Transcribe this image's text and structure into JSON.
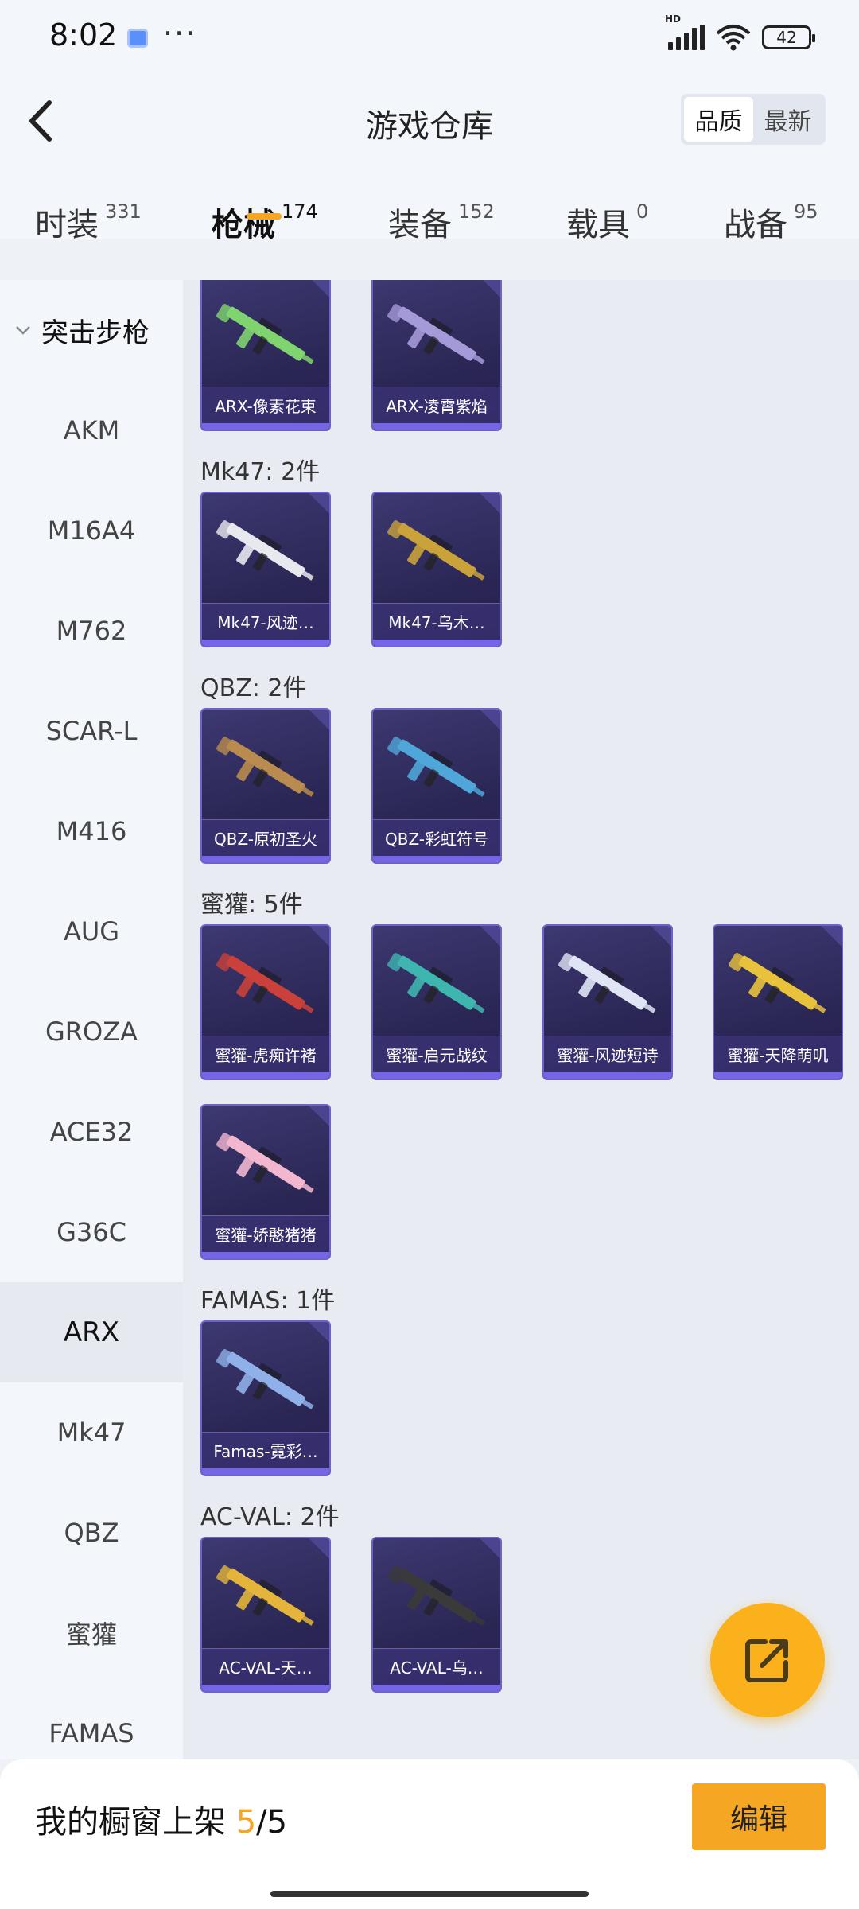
{
  "status_bar": {
    "time": "8:02",
    "dots": "···",
    "battery": "42"
  },
  "header": {
    "title": "游戏仓库",
    "sort_options": [
      "品质",
      "最新"
    ],
    "active_sort": "品质"
  },
  "tabs": [
    {
      "label": "时装",
      "count": "331"
    },
    {
      "label": "枪械",
      "count": "174",
      "active": true
    },
    {
      "label": "装备",
      "count": "152"
    },
    {
      "label": "载具",
      "count": "0"
    },
    {
      "label": "战备",
      "count": "95"
    }
  ],
  "sidebar": {
    "group_label": "突击步枪",
    "items": [
      "AKM",
      "M16A4",
      "M762",
      "SCAR-L",
      "M416",
      "AUG",
      "GROZA",
      "ACE32",
      "G36C",
      "ARX",
      "Mk47",
      "QBZ",
      "蜜獾",
      "FAMAS"
    ],
    "active": "ARX"
  },
  "sections": [
    {
      "title": "",
      "items": [
        "ARX-像素花束",
        "ARX-凌霄紫焰"
      ]
    },
    {
      "title": "Mk47: 2件",
      "items": [
        "Mk47-风迹…",
        "Mk47-乌木…"
      ]
    },
    {
      "title": "QBZ: 2件",
      "items": [
        "QBZ-原初圣火",
        "QBZ-彩虹符号"
      ]
    },
    {
      "title": "蜜獾: 5件",
      "items": [
        "蜜獾-虎痴许褚",
        "蜜獾-启元战纹",
        "蜜獾-风迹短诗",
        "蜜獾-天降萌叽",
        "蜜獾-娇憨猪猪"
      ]
    },
    {
      "title": "FAMAS: 1件",
      "items": [
        "Famas-霓彩…"
      ]
    },
    {
      "title": "AC-VAL: 2件",
      "items": [
        "AC-VAL-天…",
        "AC-VAL-乌…"
      ]
    }
  ],
  "gun_colors": {
    "ARX-像素花束": "#7fd46f",
    "ARX-凌霄紫焰": "#a59ad8",
    "Mk47-风迹…": "#e8e8ef",
    "Mk47-乌木…": "#c9a23a",
    "QBZ-原初圣火": "#b98b4e",
    "QBZ-彩虹符号": "#4fa6d8",
    "蜜獾-虎痴许褚": "#c9413a",
    "蜜獾-启元战纹": "#3fb5b0",
    "蜜獾-风迹短诗": "#dfe5f5",
    "蜜獾-天降萌叽": "#e9c23c",
    "蜜獾-娇憨猪猪": "#f2b7cf",
    "Famas-霓彩…": "#8fb0e8",
    "AC-VAL-天…": "#e4b53a",
    "AC-VAL-乌…": "#3a3a3a"
  },
  "bottom_bar": {
    "label": "我的橱窗上架",
    "count": "5",
    "total": "/5",
    "edit_label": "编辑"
  },
  "colors": {
    "accent": "#f5a623",
    "card_bg": "#2b2755",
    "card_border": "#6e63c8"
  }
}
